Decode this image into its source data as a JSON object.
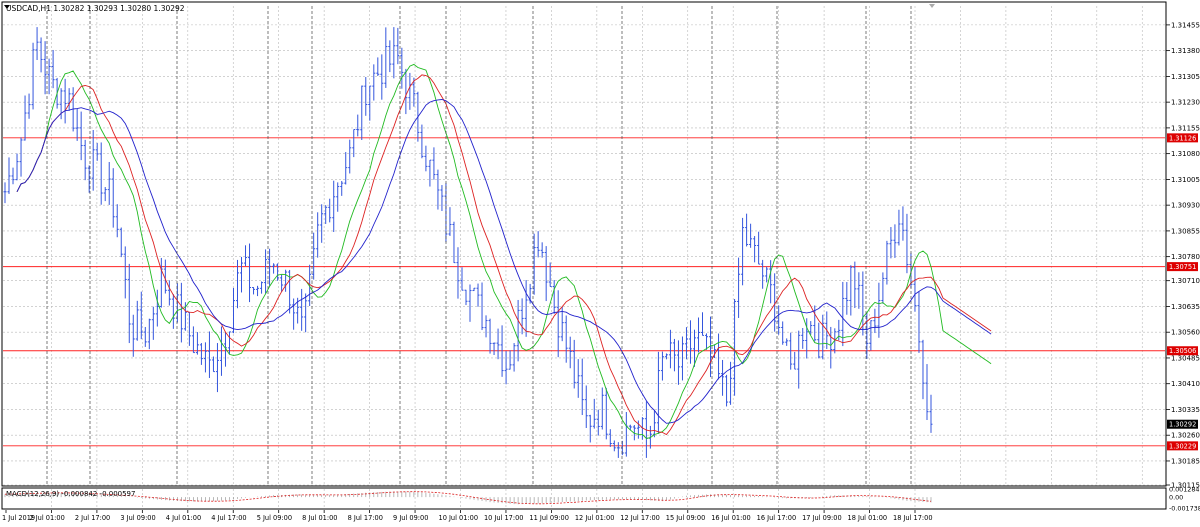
{
  "main_title": "USDCAD,H1  1.30282 1.30293 1.30280 1.30292",
  "indicator_title": "MACD(12,26,9) -0.000842 -0.000597",
  "colors": {
    "price_bars": "#3355dd",
    "ma_green": "#22bb22",
    "ma_red": "#dd2222",
    "ma_blue": "#2222cc",
    "hlines": "#ff2222",
    "price_tag_bg": "#000000",
    "hline_tag_bg": "#dd0000",
    "grid": "#b8b8b8"
  },
  "chart_data": [
    {
      "type": "line",
      "series_kind": "ohlc bars with moving averages",
      "symbol": "USDCAD",
      "timeframe": "H1",
      "ylim": [
        1.30115,
        1.3151
      ],
      "y_ticks": [
        "1.31455",
        "1.31380",
        "1.31305",
        "1.31230",
        "1.31155",
        "1.31080",
        "1.31005",
        "1.30930",
        "1.30855",
        "1.30780",
        "1.30710",
        "1.30635",
        "1.30560",
        "1.30485",
        "1.30410",
        "1.30335",
        "1.30260",
        "1.30185",
        "1.30115"
      ],
      "x_ticks": [
        "1 Jul 2019",
        "2 Jul 01:00",
        "2 Jul 17:00",
        "3 Jul 09:00",
        "4 Jul 01:00",
        "4 Jul 17:00",
        "5 Jul 09:00",
        "8 Jul 01:00",
        "8 Jul 17:00",
        "9 Jul 09:00",
        "10 Jul 01:00",
        "10 Jul 17:00",
        "11 Jul 09:00",
        "12 Jul 01:00",
        "12 Jul 17:00",
        "15 Jul 09:00",
        "16 Jul 01:00",
        "16 Jul 17:00",
        "17 Jul 09:00",
        "18 Jul 01:00",
        "18 Jul 17:00"
      ],
      "price_anchors": [
        1.3097,
        1.3112,
        1.314,
        1.3128,
        1.3125,
        1.3108,
        1.3102,
        1.3092,
        1.3058,
        1.3056,
        1.3072,
        1.3062,
        1.3053,
        1.3046,
        1.3055,
        1.3075,
        1.3068,
        1.3077,
        1.307,
        1.3055,
        1.3087,
        1.3098,
        1.3108,
        1.3128,
        1.3133,
        1.3136,
        1.3122,
        1.3105,
        1.3089,
        1.3074,
        1.3064,
        1.3057,
        1.3046,
        1.3065,
        1.3085,
        1.3064,
        1.3048,
        1.303,
        1.3034,
        1.3024,
        1.303,
        1.3024,
        1.305,
        1.3046,
        1.3055,
        1.3048,
        1.3036,
        1.3085,
        1.3076,
        1.3065,
        1.3044,
        1.306,
        1.3053,
        1.3058,
        1.3074,
        1.3052,
        1.3074,
        1.3092,
        1.3063,
        1.3029
      ],
      "horizontal_levels": [
        "1.31126",
        "1.30751",
        "1.30506",
        "1.30229"
      ],
      "current_price": "1.30292"
    },
    {
      "type": "bar",
      "indicator": "MACD(12,26,9)",
      "ylim": [
        -0.001738,
        0.001284
      ],
      "y_ticks": [
        "0.001284",
        "0.00",
        "-0.001738"
      ],
      "histogram_anchors": [
        0.00045,
        0.00068,
        0.00068,
        0.00055,
        0.00035,
        0.0001,
        -0.0003,
        -0.00062,
        -0.0007,
        -0.00055,
        -5e-05,
        0.0003,
        0.0004,
        0.0003,
        0.00045,
        0.00075,
        0.0009,
        0.0008,
        0.00035,
        -0.0003,
        -0.00085,
        -0.00115,
        -0.001,
        -0.00075,
        -0.0005,
        -0.00035,
        -0.0004,
        -0.00065,
        0.00025,
        0.00045,
        0.0003,
        0.00015,
        -0.0002,
        -0.00015,
        0.0003,
        0.0002,
        5e-05,
        -0.0006,
        -0.00085
      ]
    }
  ]
}
